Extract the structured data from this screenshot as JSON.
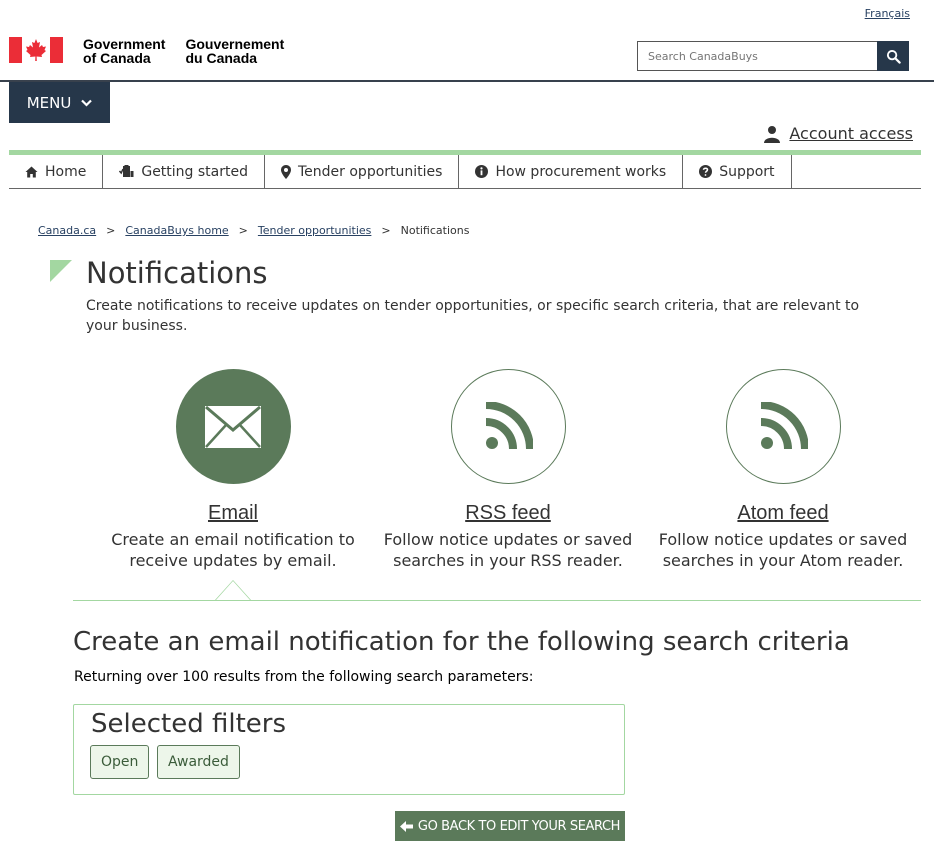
{
  "header": {
    "language_link": "Français",
    "gov_en_line1": "Government",
    "gov_en_line2": "of Canada",
    "gov_fr_line1": "Gouvernement",
    "gov_fr_line2": "du Canada",
    "search_placeholder": "Search CanadaBuys",
    "menu_label": "MENU",
    "account_label": "Account access"
  },
  "nav": [
    {
      "label": "Home",
      "icon": "home-icon"
    },
    {
      "label": "Getting started",
      "icon": "checklist-icon"
    },
    {
      "label": "Tender opportunities",
      "icon": "map-marker-icon"
    },
    {
      "label": "How procurement works",
      "icon": "info-icon"
    },
    {
      "label": "Support",
      "icon": "question-icon"
    }
  ],
  "breadcrumb": [
    "Canada.ca",
    "CanadaBuys home",
    "Tender opportunities",
    "Notifications"
  ],
  "page": {
    "title": "Notifications",
    "intro": "Create notifications to receive updates on tender opportunities, or specific search criteria, that are relevant to your business."
  },
  "options": [
    {
      "title": "Email",
      "desc": "Create an email notification to receive updates by email.",
      "icon": "envelope-icon"
    },
    {
      "title": "RSS feed",
      "desc": "Follow notice updates or saved searches in your RSS reader.",
      "icon": "rss-icon"
    },
    {
      "title": "Atom feed",
      "desc": "Follow notice updates or saved searches in your Atom reader.",
      "icon": "rss-icon"
    }
  ],
  "criteria": {
    "heading": "Create an email notification for the following search criteria",
    "returning": "Returning over 100 results from the following search parameters:",
    "filters_title": "Selected filters",
    "filters": [
      "Open",
      "Awarded"
    ],
    "back_button": "GO BACK TO EDIT YOUR SEARCH"
  },
  "colors": {
    "primary_navy": "#26374a",
    "accent_green": "#5b7a5a",
    "light_green": "#a3d7a1",
    "flag_red": "#eb2d37"
  }
}
